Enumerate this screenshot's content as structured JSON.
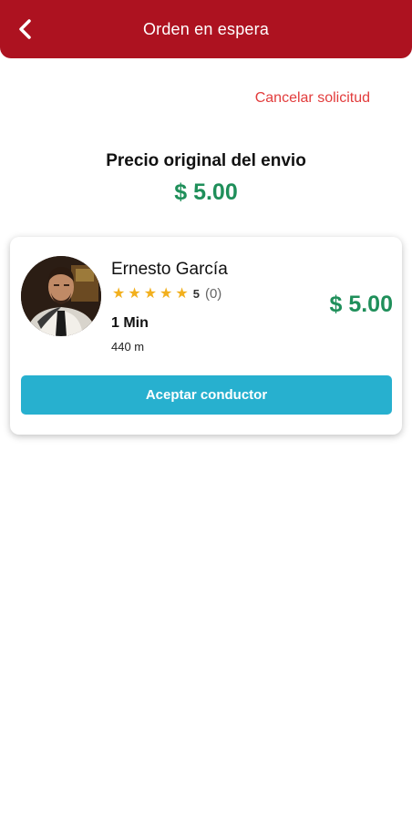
{
  "header": {
    "title": "Orden en espera",
    "back_icon": "chevron-left-icon"
  },
  "actions": {
    "cancel_label": "Cancelar solicitud"
  },
  "original": {
    "label": "Precio original del envio",
    "price": "$ 5.00"
  },
  "driver": {
    "name": "Ernesto García",
    "stars": 5,
    "rating": "5",
    "rating_count": "(0)",
    "price": "$ 5.00",
    "eta": "1 Min",
    "distance": "440 m"
  },
  "accept_label": "Aceptar conductor",
  "colors": {
    "header": "#ad1220",
    "accent_green": "#1f8f5a",
    "button": "#27b0cf",
    "cancel": "#e23c3c",
    "star": "#f2b01e"
  }
}
